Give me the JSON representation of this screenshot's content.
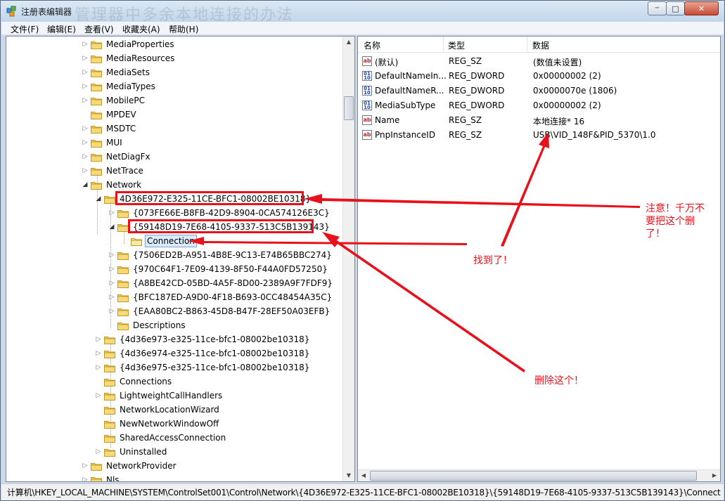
{
  "window": {
    "title": "注册表编辑器",
    "watermark": "管理器中多余本地连接的办法",
    "controls": {
      "minimize": "─",
      "maximize": "□",
      "close": "✕"
    }
  },
  "menu": [
    "文件(F)",
    "编辑(E)",
    "查看(V)",
    "收藏夹(A)",
    "帮助(H)"
  ],
  "tree": {
    "items": [
      {
        "label": "MediaProperties",
        "expander": "▷",
        "level": 0
      },
      {
        "label": "MediaResources",
        "expander": "▷",
        "level": 0
      },
      {
        "label": "MediaSets",
        "expander": "▷",
        "level": 0
      },
      {
        "label": "MediaTypes",
        "expander": "▷",
        "level": 0
      },
      {
        "label": "MobilePC",
        "expander": "▷",
        "level": 0
      },
      {
        "label": "MPDEV",
        "expander": "",
        "level": 0
      },
      {
        "label": "MSDTC",
        "expander": "▷",
        "level": 0
      },
      {
        "label": "MUI",
        "expander": "▷",
        "level": 0
      },
      {
        "label": "NetDiagFx",
        "expander": "▷",
        "level": 0
      },
      {
        "label": "NetTrace",
        "expander": "▷",
        "level": 0
      },
      {
        "label": "Network",
        "expander": "◢",
        "level": 0
      },
      {
        "label": "4D36E972-E325-11CE-BFC1-08002BE10318}",
        "expander": "◢",
        "level": 1
      },
      {
        "label": "{073FE66E-B8FB-42D9-8904-0CA574126E3C}",
        "expander": "▷",
        "level": 2
      },
      {
        "label": "{59148D19-7E68-4105-9337-513C5B139143}",
        "expander": "◢",
        "level": 2
      },
      {
        "label": "Connection",
        "expander": "",
        "level": 3,
        "selected": true
      },
      {
        "label": "{7506ED2B-A951-4B8E-9C13-E74B65BBC274}",
        "expander": "▷",
        "level": 2
      },
      {
        "label": "{970C64F1-7E09-4139-8F50-F44A0FD57250}",
        "expander": "▷",
        "level": 2
      },
      {
        "label": "{A8BE42CD-05BD-4A5F-8D00-2389A9F7FDF9}",
        "expander": "▷",
        "level": 2
      },
      {
        "label": "{BFC187ED-A9D0-4F18-B693-0CC48454A35C}",
        "expander": "▷",
        "level": 2
      },
      {
        "label": "{EAA80BC2-B863-45D8-B47F-28EF50A03EFB}",
        "expander": "▷",
        "level": 2
      },
      {
        "label": "Descriptions",
        "expander": "",
        "level": 2
      },
      {
        "label": "{4d36e973-e325-11ce-bfc1-08002be10318}",
        "expander": "▷",
        "level": 1
      },
      {
        "label": "{4d36e974-e325-11ce-bfc1-08002be10318}",
        "expander": "▷",
        "level": 1
      },
      {
        "label": "{4d36e975-e325-11ce-bfc1-08002be10318}",
        "expander": "▷",
        "level": 1
      },
      {
        "label": "Connections",
        "expander": "",
        "level": 1
      },
      {
        "label": "LightweightCallHandlers",
        "expander": "▷",
        "level": 1
      },
      {
        "label": "NetworkLocationWizard",
        "expander": "",
        "level": 1
      },
      {
        "label": "NewNetworkWindowOff",
        "expander": "",
        "level": 1
      },
      {
        "label": "SharedAccessConnection",
        "expander": "",
        "level": 1
      },
      {
        "label": "Uninstalled",
        "expander": "▷",
        "level": 1
      },
      {
        "label": "NetworkProvider",
        "expander": "▷",
        "level": 0
      },
      {
        "label": "Nls",
        "expander": "▷",
        "level": 0
      }
    ]
  },
  "list": {
    "columns": [
      "名称",
      "类型",
      "数据"
    ],
    "rows": [
      {
        "icon": "ab",
        "name": "(默认)",
        "type": "REG_SZ",
        "data": "(数值未设置)"
      },
      {
        "icon": "dw",
        "name": "DefaultNameIn...",
        "type": "REG_DWORD",
        "data": "0x00000002 (2)"
      },
      {
        "icon": "dw",
        "name": "DefaultNameR...",
        "type": "REG_DWORD",
        "data": "0x0000070e (1806)"
      },
      {
        "icon": "dw",
        "name": "MediaSubType",
        "type": "REG_DWORD",
        "data": "0x00000002 (2)"
      },
      {
        "icon": "ab",
        "name": "Name",
        "type": "REG_SZ",
        "data": "本地连接* 16"
      },
      {
        "icon": "ab",
        "name": "PnpInstanceID",
        "type": "REG_SZ",
        "data": "USB\\VID_148F&PID_5370\\1.0"
      }
    ]
  },
  "status": "计算机\\HKEY_LOCAL_MACHINE\\SYSTEM\\ControlSet001\\Control\\Network\\{4D36E972-E325-11CE-BFC1-08002BE10318}\\{59148D19-7E68-4105-9337-513C5B139143}\\Connect",
  "annotations": {
    "warning_line1": "注意！千万不",
    "warning_line2": "要把这个删",
    "warning_line3": "了！",
    "found": "找到了！",
    "delete": "删除这个！"
  },
  "colors": {
    "annotation": "#e8101a",
    "folder": "#f2c94c",
    "selection": "#d9ebfb"
  }
}
